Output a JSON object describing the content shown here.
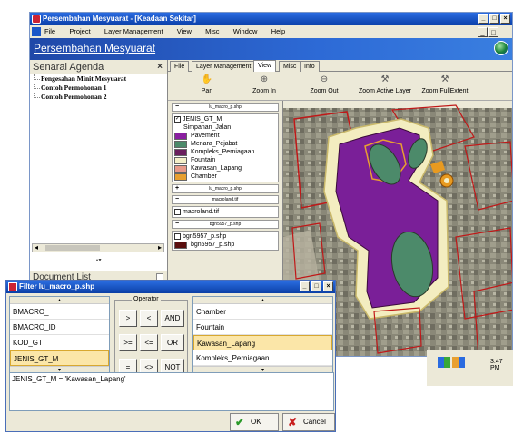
{
  "window": {
    "title": "Persembahan Mesyuarat - [Keadaan Sekitar]",
    "min": "_",
    "max": "□",
    "close": "×"
  },
  "menu": [
    "File",
    "Project",
    "Layer Management",
    "View",
    "Misc",
    "Window",
    "Help"
  ],
  "banner": {
    "title": "Persembahan Mesyuarat"
  },
  "left": {
    "agenda_title": "Senarai Agenda",
    "close": "×",
    "items": [
      "Pengesahan Minit Mesyuarat",
      "Contoh Permohonan 1",
      "Contoh Permohonan 2"
    ],
    "scroll_left": "◂",
    "scroll_right": "▸",
    "scroll_up": "▴▾",
    "doc_list": "Document List"
  },
  "tabs": [
    "File",
    "Layer Management",
    "View",
    "Misc",
    "Info"
  ],
  "active_tab": "View",
  "toolbar": [
    {
      "icon": "pan-icon",
      "glyph": "✋",
      "label": "Pan"
    },
    {
      "icon": "zoom-in-icon",
      "glyph": "⊕",
      "label": "Zoom In"
    },
    {
      "icon": "zoom-out-icon",
      "glyph": "⊖",
      "label": "Zoom Out"
    },
    {
      "icon": "zoom-active-layer-icon",
      "glyph": "⚒",
      "label": "Zoom Active Layer"
    },
    {
      "icon": "zoom-fullextent-icon",
      "glyph": "⚒",
      "label": "Zoom FullExtent"
    }
  ],
  "legend": {
    "layer1": "lu_macro_p.shp",
    "field": "JENIS_GT_M",
    "categories": [
      {
        "label": "Simpanan_Jalan",
        "color": "#ffffff"
      },
      {
        "label": "Pavement",
        "color": "#8a1fa0"
      },
      {
        "label": "Menara_Pejabat",
        "color": "#4c8a6a"
      },
      {
        "label": "Kompleks_Perniagaan",
        "color": "#6a1f5e"
      },
      {
        "label": "Fountain",
        "color": "#f4efc8"
      },
      {
        "label": "Kawasan_Lapang",
        "color": "#e89a8a"
      },
      {
        "label": "Chamber",
        "color": "#e8a030"
      }
    ],
    "layer1b": "lu_macro_p.shp",
    "layer2": "macroland.tif",
    "layer2b": "macroland.tif",
    "layer3": "bgn5957_p.shp",
    "layer3a": "bgn5957_p.shp",
    "layer3b": "bgn5957_p.shp",
    "minus": "−",
    "plus": "+",
    "check": "✓"
  },
  "tray": {
    "time": "3:47 PM"
  },
  "filter": {
    "title": "Filter lu_macro_p.shp",
    "min": "_",
    "max": "□",
    "close": "×",
    "up": "▴",
    "down": "▾",
    "fields": [
      "BMACRO_",
      "BMACRO_ID",
      "KOD_GT",
      "JENIS_GT_M"
    ],
    "selected_field": "JENIS_GT_M",
    "operator_label": "Operator",
    "operators": [
      ">",
      "<",
      "AND",
      ">=",
      "<=",
      "OR",
      "=",
      "<>",
      "NOT"
    ],
    "values": [
      "Chamber",
      "Fountain",
      "Kawasan_Lapang",
      "Kompleks_Perniagaan"
    ],
    "selected_value": "Kawasan_Lapang",
    "expression": "JENIS_GT_M = 'Kawasan_Lapang'",
    "ok_label": "OK",
    "ok_icon": "✔",
    "cancel_label": "Cancel",
    "cancel_icon": "✘"
  }
}
